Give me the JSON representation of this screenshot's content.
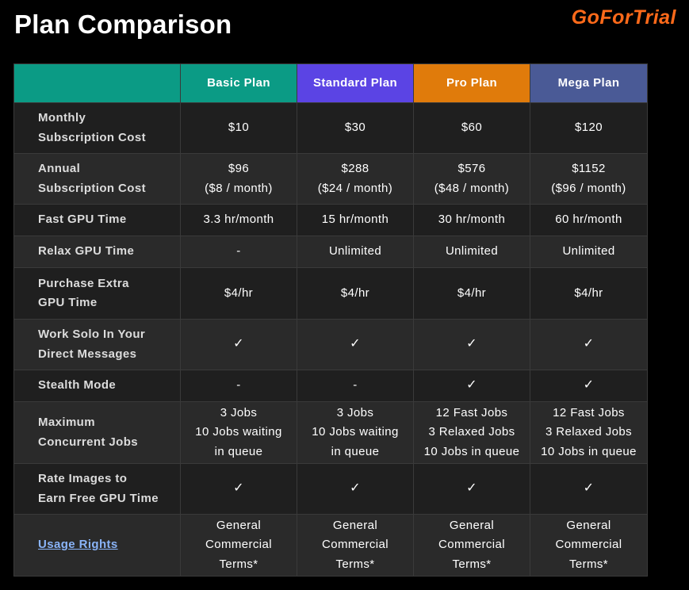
{
  "page": {
    "title": "Plan Comparison",
    "logo_text": "GoForTrial"
  },
  "colors": {
    "background": "#000000",
    "header_feature": "#0b9b85",
    "header_basic": "#0b9b85",
    "header_standard": "#5b44e4",
    "header_pro": "#e07b0b",
    "header_mega": "#4a5a96",
    "logo": "#ff6a1a",
    "link": "#8ab4f8"
  },
  "table": {
    "columns": [
      "",
      "Basic Plan",
      "Standard Plan",
      "Pro Plan",
      "Mega Plan"
    ],
    "rows": [
      {
        "label": [
          "Monthly",
          "Subscription Cost"
        ],
        "cells": [
          [
            "$10"
          ],
          [
            "$30"
          ],
          [
            "$60"
          ],
          [
            "$120"
          ]
        ]
      },
      {
        "label": [
          "Annual",
          "Subscription Cost"
        ],
        "cells": [
          [
            "$96",
            "($8 / month)"
          ],
          [
            "$288",
            "($24 / month)"
          ],
          [
            "$576",
            "($48 / month)"
          ],
          [
            "$1152",
            "($96 / month)"
          ]
        ]
      },
      {
        "label": [
          "Fast GPU Time"
        ],
        "cells": [
          [
            "3.3 hr/month"
          ],
          [
            "15 hr/month"
          ],
          [
            "30 hr/month"
          ],
          [
            "60 hr/month"
          ]
        ]
      },
      {
        "label": [
          "Relax GPU Time"
        ],
        "cells": [
          [
            "-"
          ],
          [
            "Unlimited"
          ],
          [
            "Unlimited"
          ],
          [
            "Unlimited"
          ]
        ]
      },
      {
        "label": [
          "Purchase Extra",
          "GPU Time"
        ],
        "cells": [
          [
            "$4/hr"
          ],
          [
            "$4/hr"
          ],
          [
            "$4/hr"
          ],
          [
            "$4/hr"
          ]
        ]
      },
      {
        "label": [
          "Work Solo In Your",
          "Direct Messages"
        ],
        "cells": [
          [
            "✓"
          ],
          [
            "✓"
          ],
          [
            "✓"
          ],
          [
            "✓"
          ]
        ]
      },
      {
        "label": [
          "Stealth Mode"
        ],
        "cells": [
          [
            "-"
          ],
          [
            "-"
          ],
          [
            "✓"
          ],
          [
            "✓"
          ]
        ]
      },
      {
        "label": [
          "Maximum",
          "Concurrent Jobs"
        ],
        "cells": [
          [
            "3 Jobs",
            "10 Jobs waiting",
            "in queue"
          ],
          [
            "3 Jobs",
            "10 Jobs waiting",
            "in queue"
          ],
          [
            "12 Fast Jobs",
            "3 Relaxed Jobs",
            "10 Jobs in queue"
          ],
          [
            "12 Fast Jobs",
            "3 Relaxed Jobs",
            "10 Jobs in queue"
          ]
        ]
      },
      {
        "label": [
          "Rate Images to",
          "Earn Free GPU Time"
        ],
        "cells": [
          [
            "✓"
          ],
          [
            "✓"
          ],
          [
            "✓"
          ],
          [
            "✓"
          ]
        ]
      },
      {
        "label": [
          "Usage Rights"
        ],
        "cells": [
          [
            "General",
            "Commercial",
            "Terms*"
          ],
          [
            "General",
            "Commercial",
            "Terms*"
          ],
          [
            "General",
            "Commercial",
            "Terms*"
          ],
          [
            "General",
            "Commercial",
            "Terms*"
          ]
        ]
      }
    ]
  }
}
